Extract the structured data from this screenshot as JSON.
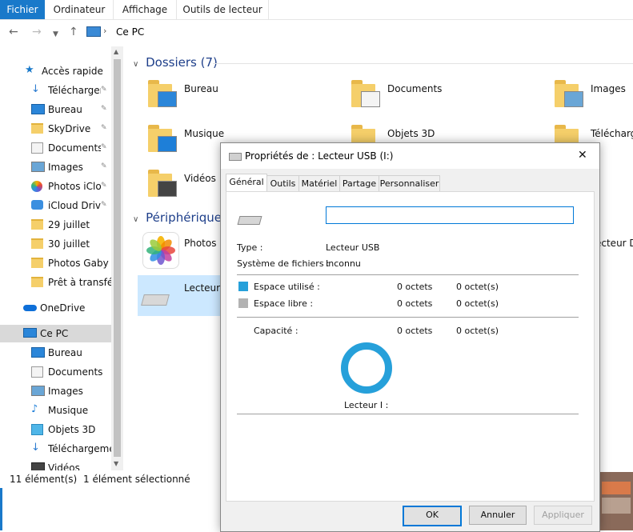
{
  "ribbon": {
    "tabs": [
      "Fichier",
      "Ordinateur",
      "Affichage",
      "Outils de lecteur"
    ]
  },
  "address": {
    "path": "Ce PC"
  },
  "sidebar": {
    "items": [
      {
        "label": "Accès rapide",
        "icon": "star-icon",
        "pinned": false
      },
      {
        "label": "Téléchargeme",
        "icon": "download-icon",
        "pinned": true
      },
      {
        "label": "Bureau",
        "icon": "desktop-icon",
        "pinned": true
      },
      {
        "label": "SkyDrive",
        "icon": "folder-icon",
        "pinned": true
      },
      {
        "label": "Documents",
        "icon": "documents-icon",
        "pinned": true
      },
      {
        "label": "Images",
        "icon": "images-icon",
        "pinned": true
      },
      {
        "label": "Photos iClou",
        "icon": "photos-icon",
        "pinned": true
      },
      {
        "label": "iCloud Drive",
        "icon": "icloud-icon",
        "pinned": true
      },
      {
        "label": "29 juillet",
        "icon": "folder-icon",
        "pinned": false
      },
      {
        "label": "30 juillet",
        "icon": "folder-icon",
        "pinned": false
      },
      {
        "label": "Photos Gaby",
        "icon": "folder-icon",
        "pinned": false
      },
      {
        "label": "Prêt à transférer",
        "icon": "folder-icon",
        "pinned": false
      },
      {
        "label": "OneDrive",
        "icon": "onedrive-icon",
        "pinned": false
      },
      {
        "label": "Ce PC",
        "icon": "computer-icon",
        "pinned": false
      },
      {
        "label": "Bureau",
        "icon": "desktop-icon",
        "pinned": false
      },
      {
        "label": "Documents",
        "icon": "documents-icon",
        "pinned": false
      },
      {
        "label": "Images",
        "icon": "images-icon",
        "pinned": false
      },
      {
        "label": "Musique",
        "icon": "music-icon",
        "pinned": false
      },
      {
        "label": "Objets 3D",
        "icon": "objects3d-icon",
        "pinned": false
      },
      {
        "label": "Téléchargements",
        "icon": "download-icon",
        "pinned": false
      },
      {
        "label": "Vidéos",
        "icon": "videos-icon",
        "pinned": false
      }
    ]
  },
  "main": {
    "folders_heading": "Dossiers (7)",
    "folders": [
      "Bureau",
      "Documents",
      "Images",
      "Musique",
      "Objets 3D",
      "Téléchargem",
      "Vidéos"
    ],
    "devices_heading": "Périphériques e",
    "devices": [
      "Photos i",
      "Lecteur U",
      "ecteur DV"
    ]
  },
  "status": {
    "count": "11 élément(s)",
    "selected": "1 élément sélectionné"
  },
  "dialog": {
    "title": "Propriétés de : Lecteur USB (I:)",
    "close": "✕",
    "tabs": [
      "Général",
      "Outils",
      "Matériel",
      "Partage",
      "Personnaliser"
    ],
    "name_value": "",
    "type_label": "Type :",
    "type_value": "Lecteur USB",
    "fs_label": "Système de fichiers :",
    "fs_value": "Inconnu",
    "used_label": "Espace utilisé :",
    "used_bytes": "0 octets",
    "used_size": "0 octet(s)",
    "free_label": "Espace libre :",
    "free_bytes": "0 octets",
    "free_size": "0 octet(s)",
    "capacity_label": "Capacité :",
    "capacity_bytes": "0 octets",
    "capacity_size": "0 octet(s)",
    "drive_label": "Lecteur I :",
    "buttons": {
      "ok": "OK",
      "cancel": "Annuler",
      "apply": "Appliquer"
    },
    "colors": {
      "used": "#26a0da",
      "free": "#b2b2b2",
      "ring": "#26a0da"
    }
  }
}
